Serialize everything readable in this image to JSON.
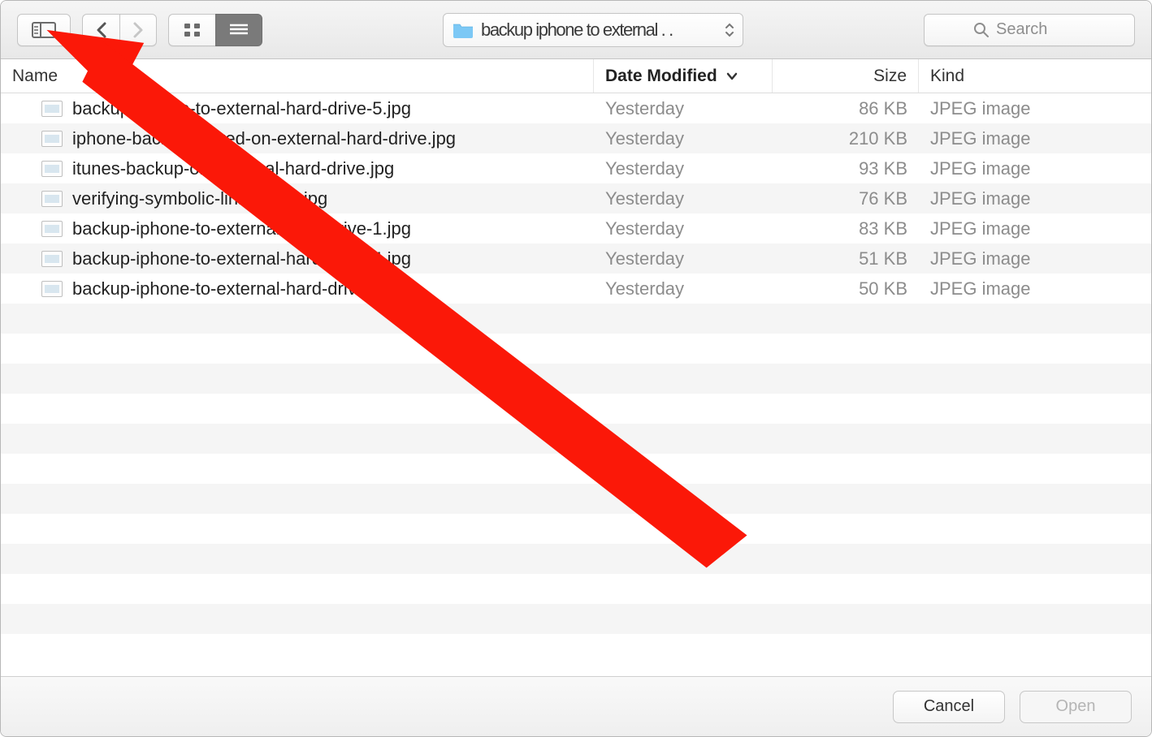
{
  "toolbar": {
    "path_label": "backup iphone to external . .",
    "search_placeholder": "Search"
  },
  "columns": {
    "name": "Name",
    "date": "Date Modified",
    "size": "Size",
    "kind": "Kind"
  },
  "files": [
    {
      "name": "backup-iphone-to-external-hard-drive-5.jpg",
      "date": "Yesterday",
      "size": "86 KB",
      "kind": "JPEG image"
    },
    {
      "name": "iphone-backup-stored-on-external-hard-drive.jpg",
      "date": "Yesterday",
      "size": "210 KB",
      "kind": "JPEG image"
    },
    {
      "name": "itunes-backup-on-external-hard-drive.jpg",
      "date": "Yesterday",
      "size": "93 KB",
      "kind": "JPEG image"
    },
    {
      "name": "verifying-symbolic-link-exists.jpg",
      "date": "Yesterday",
      "size": "76 KB",
      "kind": "JPEG image"
    },
    {
      "name": "backup-iphone-to-external-hard-drive-1.jpg",
      "date": "Yesterday",
      "size": "83 KB",
      "kind": "JPEG image"
    },
    {
      "name": "backup-iphone-to-external-hard-drive-4.jpg",
      "date": "Yesterday",
      "size": "51 KB",
      "kind": "JPEG image"
    },
    {
      "name": "backup-iphone-to-external-hard-drive-6.jpg",
      "date": "Yesterday",
      "size": "50 KB",
      "kind": "JPEG image"
    }
  ],
  "footer": {
    "cancel": "Cancel",
    "open": "Open"
  }
}
